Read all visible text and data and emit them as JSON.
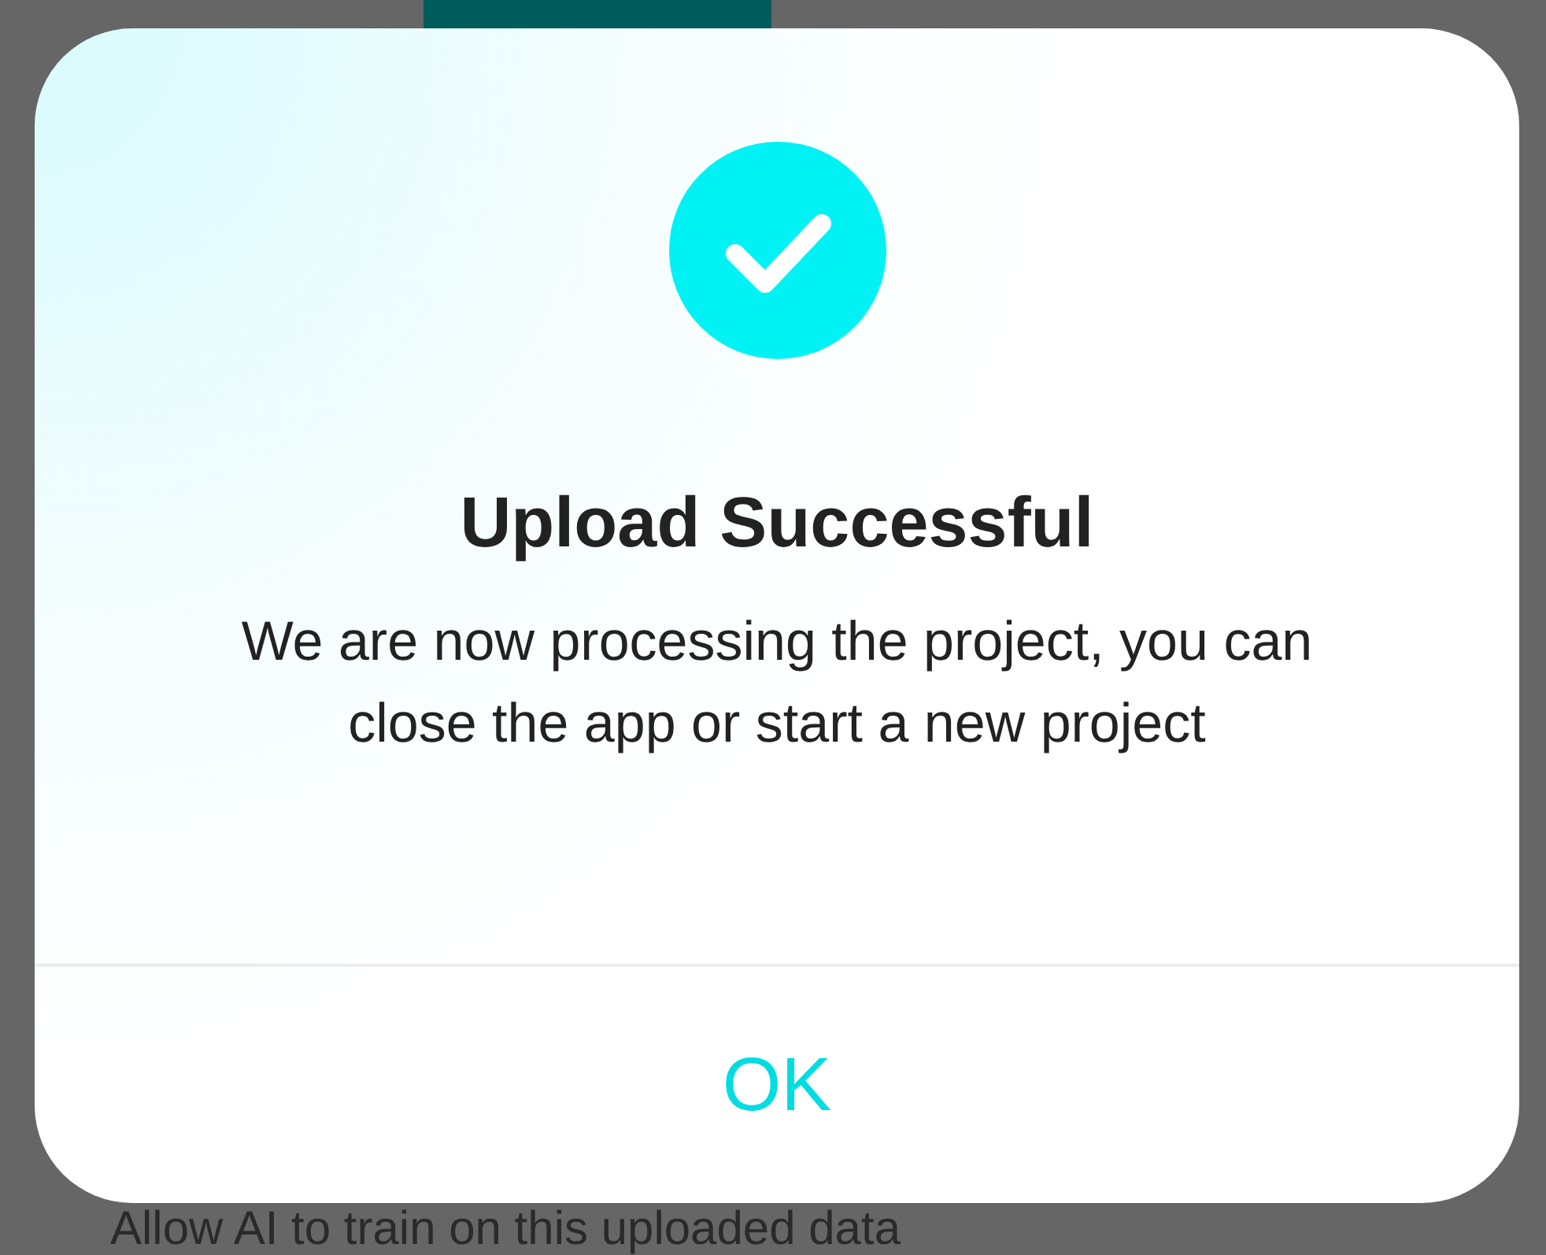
{
  "background": {
    "hint": "Allow AI to train on this uploaded data"
  },
  "dialog": {
    "title": "Upload Successful",
    "message": "We are now processing the project, you can close the app or start a new project",
    "buttons": [
      "OK"
    ]
  }
}
